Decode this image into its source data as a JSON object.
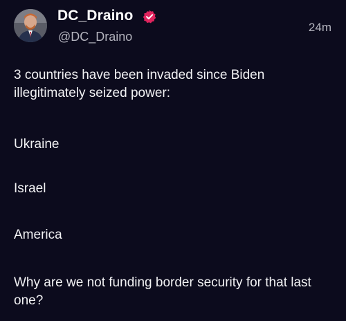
{
  "post": {
    "author": {
      "display_name": "DC_Draino",
      "handle": "@DC_Draino",
      "verified": true,
      "avatar_icon": "avatar-icon",
      "verified_badge_color": "#e0245e"
    },
    "timestamp": "24m",
    "body": {
      "line_1": "3 countries have been invaded since Biden illegitimately seized power:",
      "line_2": "Ukraine",
      "line_3": "Israel",
      "line_4": "America",
      "line_5": "Why are we not funding border security for that last one?"
    }
  },
  "colors": {
    "background": "#0c0b1d",
    "text_primary": "#f2f2f4",
    "text_secondary": "#b4b4be"
  }
}
